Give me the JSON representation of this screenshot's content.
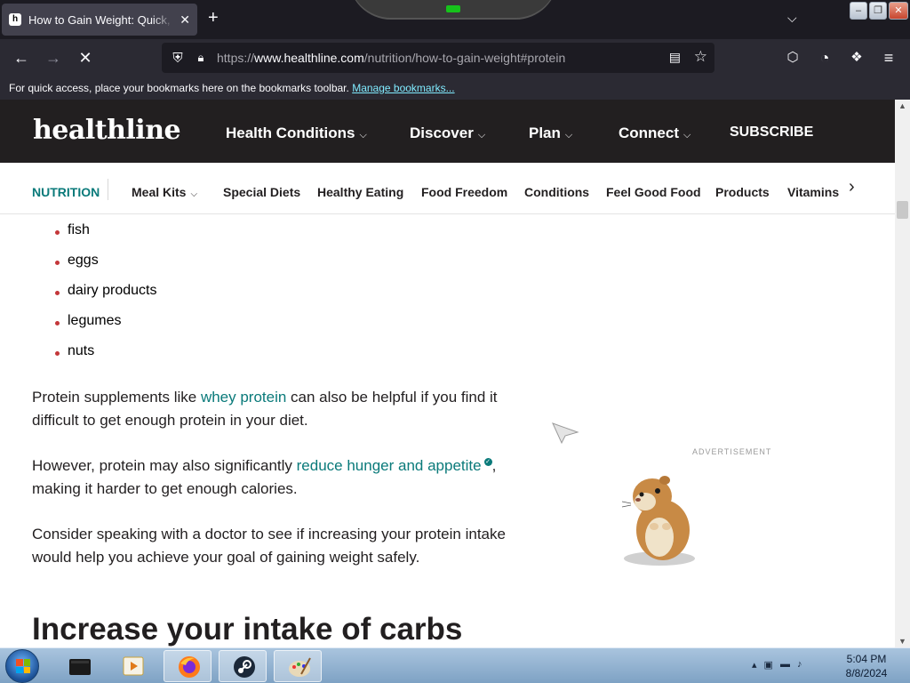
{
  "browser": {
    "tab_title": "How to Gain Weight: Quick, Safe",
    "tab_favicon": "h",
    "tab_close": "✕",
    "new_tab": "+",
    "url_domain": "www.healthline.com",
    "url_prefix": "https://",
    "url_path": "/nutrition/how-to-gain-weight#protein",
    "bookmarks_message": "For quick access, place your bookmarks here on the bookmarks toolbar.",
    "bookmarks_link": "Manage bookmarks..."
  },
  "site": {
    "logo": "healthline",
    "nav": [
      "Health Conditions",
      "Discover",
      "Plan",
      "Connect"
    ],
    "subscribe": "SUBSCRIBE",
    "subnav_section": "NUTRITION",
    "subnav": [
      "Meal Kits",
      "Special Diets",
      "Healthy Eating",
      "Food Freedom",
      "Conditions",
      "Feel Good Food",
      "Products",
      "Vitamins"
    ]
  },
  "article": {
    "bullets": [
      "fish",
      "eggs",
      "dairy products",
      "legumes",
      "nuts"
    ],
    "p1_before": "Protein supplements like ",
    "p1_link": "whey protein",
    "p1_after": " can also be helpful if you find it difficult to get enough protein in your diet.",
    "p2_before": "However, protein may also significantly ",
    "p2_link": "reduce hunger and appetite",
    "p2_after": ", making it harder to get enough calories.",
    "p3": "Consider speaking with a doctor to see if increasing your protein intake would help you achieve your goal of gaining weight safely.",
    "heading": "Increase your intake of carbs",
    "ad_label": "ADVERTISEMENT"
  },
  "taskbar": {
    "time": "5:04 PM",
    "date": "8/8/2024",
    "apps": [
      "terminal-icon",
      "media-player-icon",
      "firefox-icon",
      "steam-icon",
      "paint-icon"
    ]
  },
  "colors": {
    "brand_dark": "#221f20",
    "link_teal": "#0a7a7a",
    "bullet_red": "#c4373a"
  }
}
